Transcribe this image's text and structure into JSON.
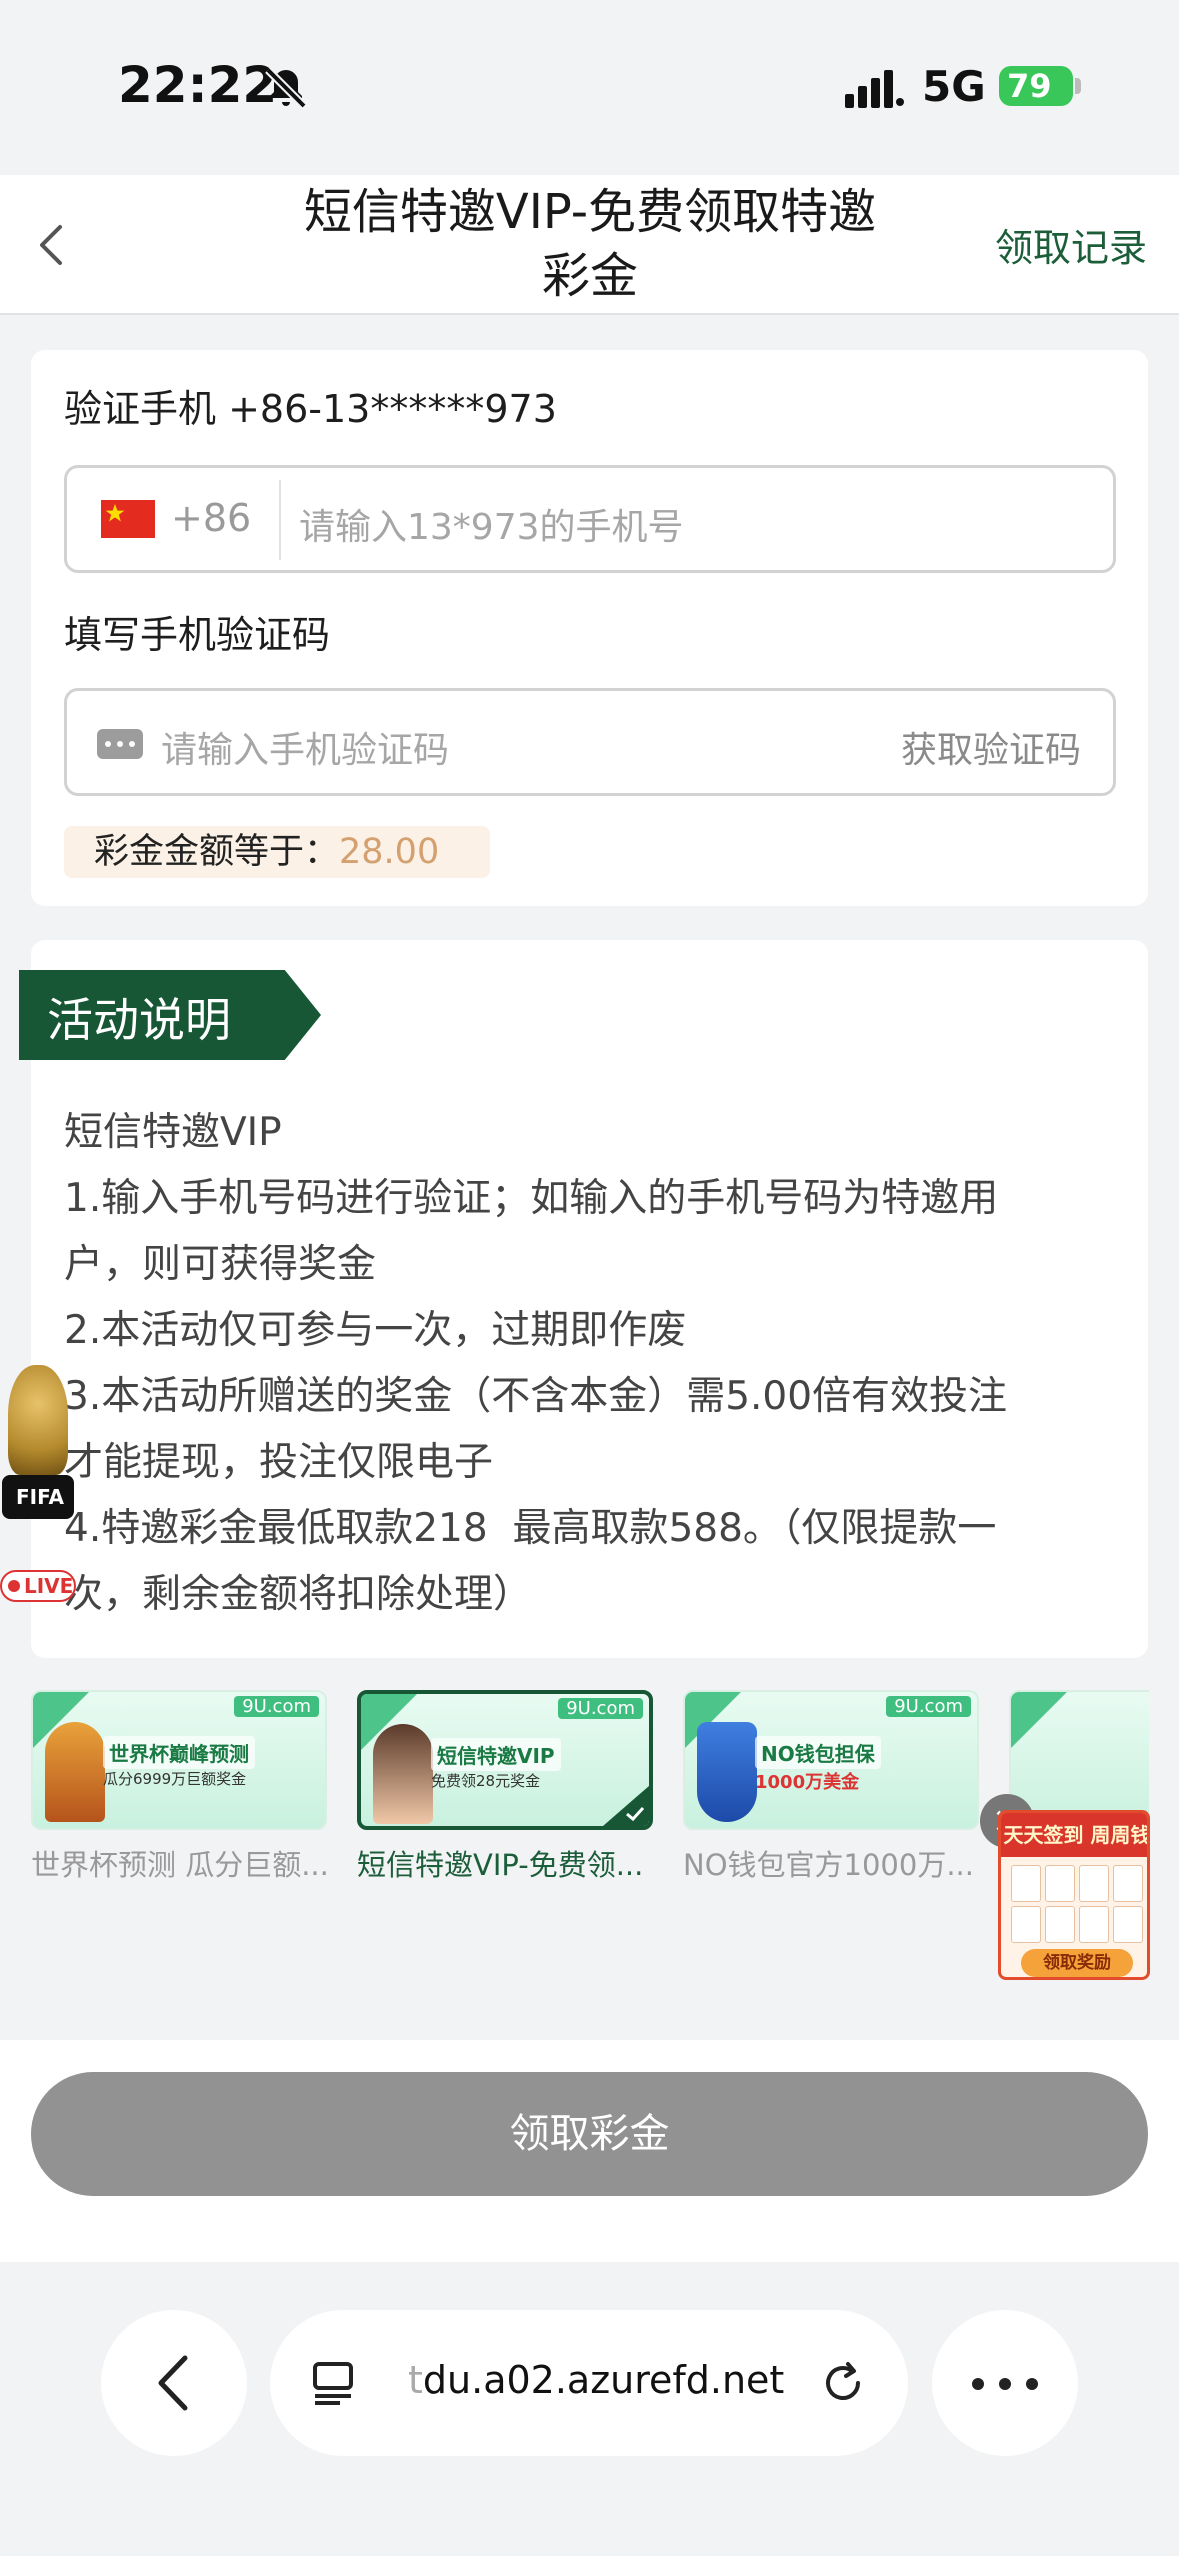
{
  "status_bar": {
    "time": "22:22",
    "network": "5G",
    "battery": "79"
  },
  "nav": {
    "title_line1": "短信特邀VIP-免费领取特邀",
    "title_line2": "彩金",
    "records_label": "领取记录"
  },
  "verify": {
    "phone_label": "验证手机 +86-13******973",
    "country_code": "+86",
    "phone_placeholder": "请输入13*973的手机号",
    "code_label": "填写手机验证码",
    "code_placeholder": "请输入手机验证码",
    "get_code_label": "获取验证码",
    "amount_label": "彩金金额等于：",
    "amount_value": "28.00"
  },
  "activity": {
    "title": "活动说明",
    "lines": [
      "短信特邀VIP",
      "1.输入手机号码进行验证；如输入的手机号码为特邀用",
      "户，则可获得奖金",
      "2.本活动仅可参与一次，过期即作废",
      "3.本活动所赠送的奖金（不含本金）需5.00倍有效投注",
      "才能提现，投注仅限电子",
      "4.特邀彩金最低取款218  最高取款588。（仅限提款一",
      "次，剩余金额将扣除处理）"
    ]
  },
  "world_cup_float": {
    "fifa": "FIFA",
    "live": "LIVE"
  },
  "banners": [
    {
      "tag": "9U.com",
      "headline": "世界杯巅峰预测",
      "sub": "瓜分6999万巨额奖金",
      "caption": "世界杯预测 瓜分巨额...",
      "selected": false
    },
    {
      "tag": "9U.com",
      "headline": "短信特邀VIP",
      "sub": "免费领28元奖金",
      "caption": "短信特邀VIP-免费领...",
      "selected": true
    },
    {
      "tag": "9U.com",
      "headline": "NO钱包担保",
      "sub": "1000万美金",
      "caption": "NO钱包官方1000万...",
      "selected": false
    }
  ],
  "signin_float": {
    "title": "天天签到 周周钱到",
    "button": "领取奖励"
  },
  "claim_button": "领取彩金",
  "browser": {
    "url_faded": "t",
    "url": "du.a02.azurefd.net"
  },
  "colors": {
    "brand_green": "#175735",
    "accent_gold": "#d4a070",
    "disabled_gray": "#929292"
  }
}
